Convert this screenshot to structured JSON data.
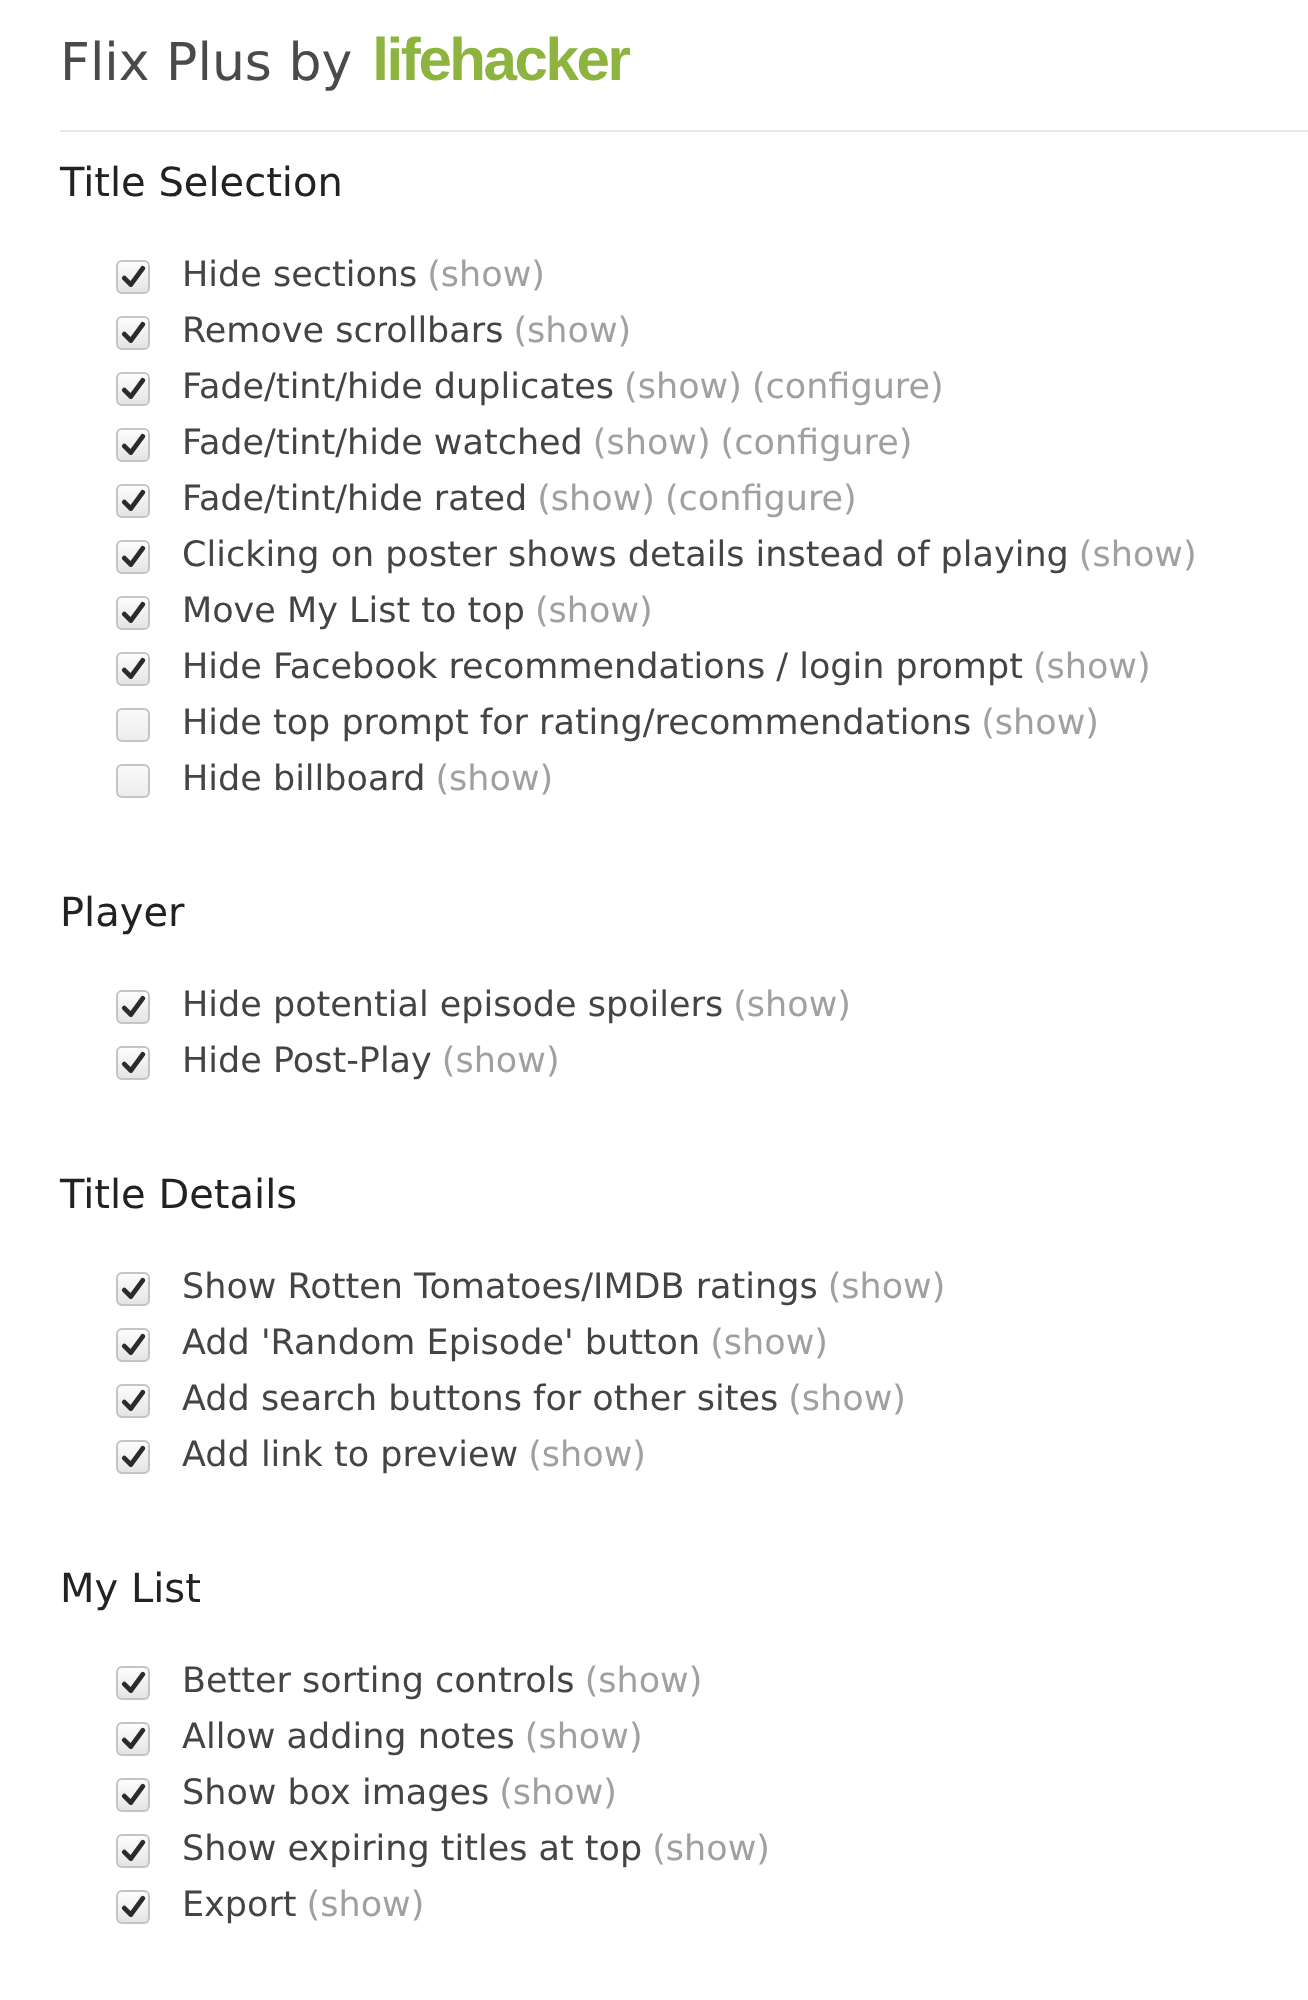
{
  "header": {
    "title": "Flix Plus by",
    "logo": "lifehacker"
  },
  "sections": [
    {
      "heading": "Title Selection",
      "options": [
        {
          "label": "Hide sections",
          "checked": true,
          "links": [
            "(show)"
          ]
        },
        {
          "label": "Remove scrollbars",
          "checked": true,
          "links": [
            "(show)"
          ]
        },
        {
          "label": "Fade/tint/hide duplicates",
          "checked": true,
          "links": [
            "(show)",
            "(configure)"
          ]
        },
        {
          "label": "Fade/tint/hide watched",
          "checked": true,
          "links": [
            "(show)",
            "(configure)"
          ]
        },
        {
          "label": "Fade/tint/hide rated",
          "checked": true,
          "links": [
            "(show)",
            "(configure)"
          ]
        },
        {
          "label": "Clicking on poster shows details instead of playing",
          "checked": true,
          "links": [
            "(show)"
          ]
        },
        {
          "label": "Move My List to top",
          "checked": true,
          "links": [
            "(show)"
          ]
        },
        {
          "label": "Hide Facebook recommendations / login prompt",
          "checked": true,
          "links": [
            "(show)"
          ]
        },
        {
          "label": "Hide top prompt for rating/recommendations",
          "checked": false,
          "links": [
            "(show)"
          ]
        },
        {
          "label": "Hide billboard",
          "checked": false,
          "links": [
            "(show)"
          ]
        }
      ]
    },
    {
      "heading": "Player",
      "options": [
        {
          "label": "Hide potential episode spoilers",
          "checked": true,
          "links": [
            "(show)"
          ]
        },
        {
          "label": "Hide Post-Play",
          "checked": true,
          "links": [
            "(show)"
          ]
        }
      ]
    },
    {
      "heading": "Title Details",
      "options": [
        {
          "label": "Show Rotten Tomatoes/IMDB ratings",
          "checked": true,
          "links": [
            "(show)"
          ]
        },
        {
          "label": "Add 'Random Episode' button",
          "checked": true,
          "links": [
            "(show)"
          ]
        },
        {
          "label": "Add search buttons for other sites",
          "checked": true,
          "links": [
            "(show)"
          ]
        },
        {
          "label": "Add link to preview",
          "checked": true,
          "links": [
            "(show)"
          ]
        }
      ]
    },
    {
      "heading": "My List",
      "options": [
        {
          "label": "Better sorting controls",
          "checked": true,
          "links": [
            "(show)"
          ]
        },
        {
          "label": "Allow adding notes",
          "checked": true,
          "links": [
            "(show)"
          ]
        },
        {
          "label": "Show box images",
          "checked": true,
          "links": [
            "(show)"
          ]
        },
        {
          "label": "Show expiring titles at top",
          "checked": true,
          "links": [
            "(show)"
          ]
        },
        {
          "label": "Export",
          "checked": true,
          "links": [
            "(show)"
          ]
        }
      ]
    }
  ]
}
